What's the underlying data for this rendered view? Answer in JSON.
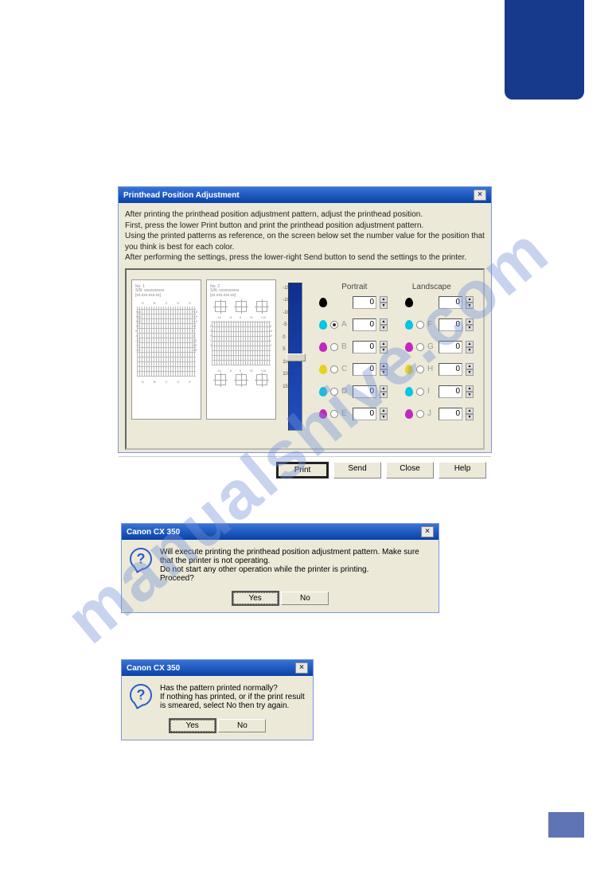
{
  "watermark": "manualshive.com",
  "dialog1": {
    "title": "Printhead Position Adjustment",
    "instructions": [
      "After printing the printhead position adjustment pattern, adjust the printhead position.",
      "First, press the lower Print button and print the printhead position adjustment pattern.",
      "Using the printed patterns as reference, on the screen below set the number value for the position that you think is best for each color.",
      "After performing the settings, press the lower-right Send button to send the settings to the printer."
    ],
    "preview1": {
      "no": "No. 1",
      "sn": "S/N: xxxxxxxxxx",
      "date": "[xx.xxx.xxx.xx]"
    },
    "preview2": {
      "no": "No. 2",
      "sn": "S/N: xxxxxxxxxx",
      "date": "[xx.xxx.xxx.xx]"
    },
    "slider_labels": [
      "-15",
      "-10",
      "-10",
      "-5",
      "0",
      "5",
      "10",
      "10",
      "15"
    ],
    "columns": {
      "portrait": "Portrait",
      "landscape": "Landscape"
    },
    "rows": [
      {
        "color": "#000",
        "p_radio": false,
        "p_label": "",
        "p_val": "0",
        "l_radio": false,
        "l_label": "",
        "l_val": "0",
        "mode": "solid"
      },
      {
        "color": "#06c6e0",
        "p_radio": true,
        "p_label": "A",
        "p_val": "0",
        "l_radio": false,
        "l_label": "F",
        "l_val": "0"
      },
      {
        "color": "#c028c0",
        "p_radio": false,
        "p_label": "B",
        "p_val": "0",
        "l_radio": false,
        "l_label": "G",
        "l_val": "0"
      },
      {
        "color": "#e8d020",
        "p_radio": false,
        "p_label": "C",
        "p_val": "0",
        "l_radio": false,
        "l_label": "H",
        "l_val": "0"
      },
      {
        "color": "#06c6e0",
        "p_radio": false,
        "p_label": "D",
        "p_val": "0",
        "l_radio": false,
        "l_label": "I",
        "l_val": "0"
      },
      {
        "color": "#c028c0",
        "p_radio": false,
        "p_label": "E",
        "p_val": "0",
        "l_radio": false,
        "l_label": "J",
        "l_val": "0"
      }
    ],
    "buttons": {
      "print": "Print",
      "send": "Send",
      "close": "Close",
      "help": "Help"
    }
  },
  "dialog2": {
    "title": "Canon CX 350",
    "lines": [
      "Will execute printing the printhead position adjustment pattern. Make sure that the printer is not operating.",
      "Do not start any other operation while the printer is printing.",
      "Proceed?"
    ],
    "yes": "Yes",
    "no": "No"
  },
  "dialog3": {
    "title": "Canon CX 350",
    "lines": [
      "Has the pattern printed normally?",
      "If nothing has printed, or if the print result is smeared, select No then try again."
    ],
    "yes": "Yes",
    "no": "No"
  }
}
